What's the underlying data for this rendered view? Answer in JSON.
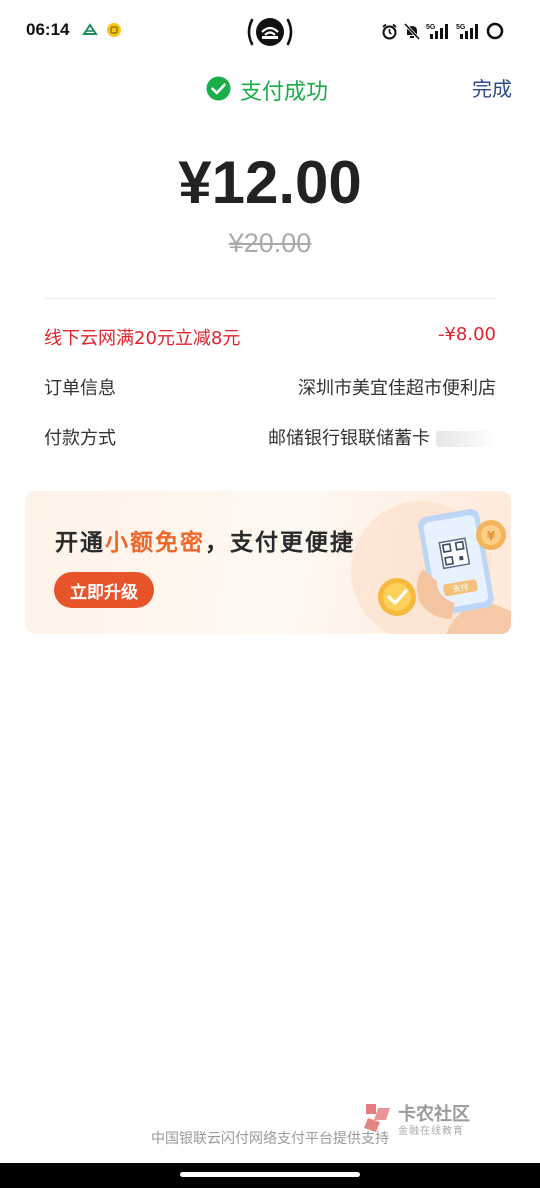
{
  "status_bar": {
    "time": "06:14",
    "icons": [
      "carrier-icon",
      "coin-app-icon",
      "hotspot-icon",
      "alarm-icon",
      "mute-icon",
      "signal-5g-icon",
      "signal-5g-icon",
      "battery-ring-icon"
    ],
    "network_labels": [
      "5G",
      "5G"
    ]
  },
  "header": {
    "status_text": "支付成功",
    "done_label": "完成"
  },
  "payment": {
    "amount": "¥12.00",
    "original_amount": "¥20.00"
  },
  "details": {
    "discount_label": "线下云网满20元立减8元",
    "discount_value": "-¥8.00",
    "order_label": "订单信息",
    "order_value": "深圳市美宜佳超市便利店",
    "payment_label": "付款方式",
    "payment_value": "邮储银行银联储蓄卡"
  },
  "promo": {
    "title_prefix": "开通",
    "title_highlight": "小额免密",
    "title_suffix": "，支付更便捷",
    "button_label": "立即升级",
    "illustration_label": "支付"
  },
  "footer": {
    "text": "中国银联云闪付网络支付平台提供支持"
  },
  "watermark": {
    "title": "卡农社区",
    "subtitle": "金融在线教育"
  },
  "colors": {
    "success_green": "#1aad4a",
    "discount_red": "#e0242b",
    "promo_orange": "#e8542a",
    "link_blue": "#2d4c8a"
  }
}
